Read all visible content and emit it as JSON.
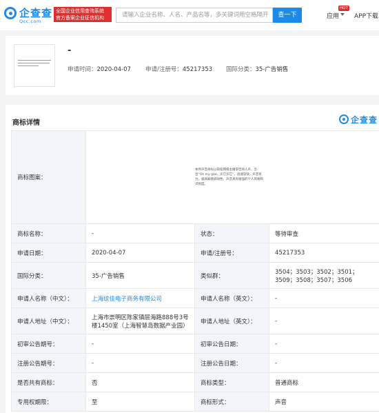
{
  "header": {
    "logo_text": "企查查",
    "logo_sub": "Qcc.com",
    "gov_badge_line1": "全国企业信用查询系统",
    "gov_badge_line2": "官方备案企业征信机构",
    "search_placeholder": "请输入企业名称、人名、产品名等，多关键词用空格隔开",
    "search_button": "查一下",
    "app_label": "应用",
    "hot_badge": "HOT",
    "app_download": "APP下载"
  },
  "summary": {
    "title": "-",
    "apply_date_label": "申请时间：",
    "apply_date": "2020-04-07",
    "reg_no_label": "申请/注册号：",
    "reg_no": "45217353",
    "intl_class_label": "国际分类：",
    "intl_class": "35-广告销售"
  },
  "details": {
    "section_title": "商标详情",
    "watermark": "企查查",
    "image_label": "商标图案：",
    "image_text": "本件声音商标以知名网络主播李佳琦人声，念出“Oh my god，买它买它”，语速较快，声音有力，极具煽情调动性，声音具有极强的个人风格和识别度。",
    "rows": [
      {
        "l1": "商标名称：",
        "v1": "-",
        "l2": "状态：",
        "v2": "等待审查"
      },
      {
        "l1": "申请日期：",
        "v1": "2020-04-07",
        "l2": "申请/注册号：",
        "v2": "45217353"
      },
      {
        "l1": "国际分类：",
        "v1": "35-广告销售",
        "l2": "类似群：",
        "v2": "3504；3503；3502；3501；3509；3508；3507；3506"
      },
      {
        "l1": "申请人名称（中文）：",
        "v1": "上海纹佳电子商务有限公司",
        "l2": "申请人名称（英文）：",
        "v2": "-"
      },
      {
        "l1": "申请人地址（中文）：",
        "v1": "上海市崇明区陈家镇层海路888号3号楼1450室（上海智慧岛数据产业园）",
        "l2": "申请人地址（英文）：",
        "v2": "-"
      },
      {
        "l1": "初审公告期号：",
        "v1": "-",
        "l2": "初审公告日期：",
        "v2": "-"
      },
      {
        "l1": "注册公告期号：",
        "v1": "-",
        "l2": "注册公告日期：",
        "v2": "-"
      },
      {
        "l1": "是否共有商标：",
        "v1": "否",
        "l2": "商标类型：",
        "v2": "普通商标"
      },
      {
        "l1": "专用权期限：",
        "v1": "至",
        "l2": "商标形式：",
        "v2": "声音"
      }
    ]
  }
}
